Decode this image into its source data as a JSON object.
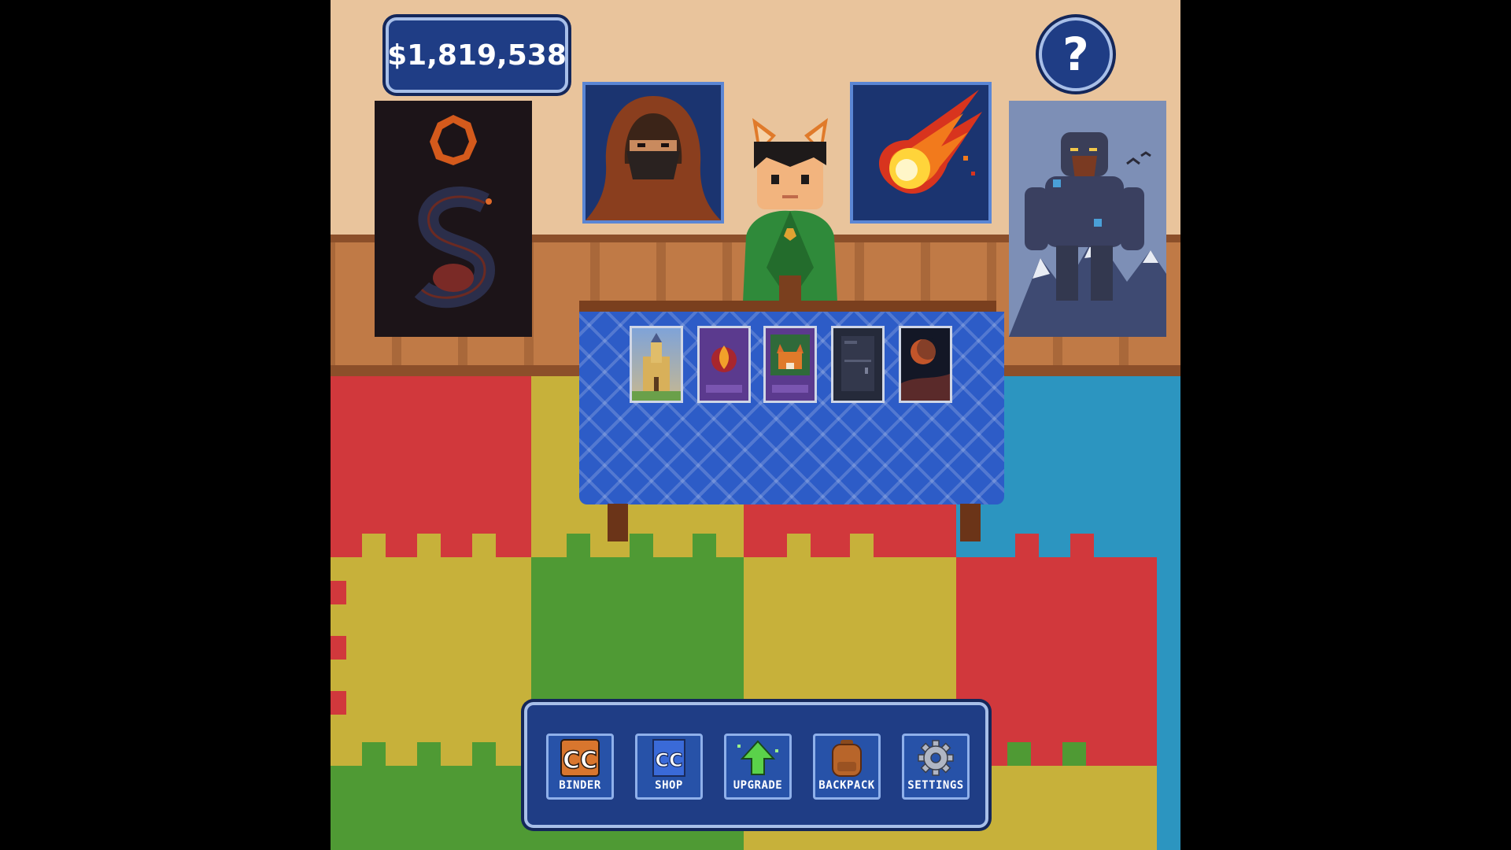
{
  "hud": {
    "money": "$1,819,538",
    "help_symbol": "?"
  },
  "menu": {
    "items": [
      {
        "label": "BINDER",
        "icon": "binder-icon"
      },
      {
        "label": "SHOP",
        "icon": "shop-icon"
      },
      {
        "label": "UPGRADE",
        "icon": "upgrade-arrow-icon"
      },
      {
        "label": "BACKPACK",
        "icon": "backpack-icon"
      },
      {
        "label": "SETTINGS",
        "icon": "gear-icon"
      }
    ]
  },
  "wall_posters": [
    "eclipse-serpent-poster",
    "hooded-rogue-portrait",
    "fireball-portrait",
    "mountain-giant-poster"
  ],
  "table_cards": [
    "castle-card",
    "fire-rune-card",
    "fox-card",
    "dark-locker-card",
    "blood-moon-card"
  ],
  "colors": {
    "panel": "#1f3d85",
    "panel_border": "#a8bfe8",
    "wall": "#e9c49c",
    "wood": "#c07a46",
    "rug_red": "#d1383c",
    "rug_yellow": "#c7b13a",
    "rug_green": "#4f9a34",
    "rug_blue": "#2c95c0"
  }
}
